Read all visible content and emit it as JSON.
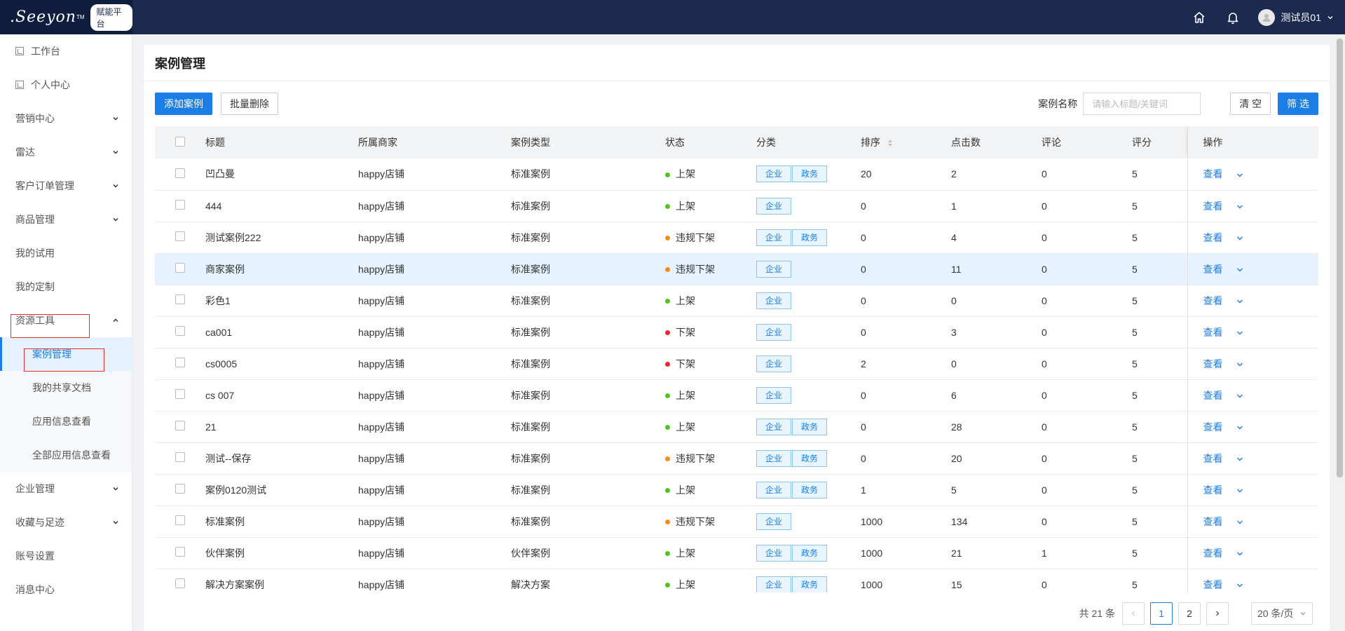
{
  "header": {
    "logo_text": ".Seeyon",
    "logo_tm": "TM",
    "platform_badge": "赋能平台",
    "user_name": "测试员01"
  },
  "sidebar": {
    "items": [
      {
        "label": "工作台",
        "icon": "square-icon"
      },
      {
        "label": "个人中心",
        "icon": "square-icon"
      },
      {
        "label": "营销中心",
        "expandable": true
      },
      {
        "label": "雷达",
        "expandable": true
      },
      {
        "label": "客户订单管理",
        "expandable": true
      },
      {
        "label": "商品管理",
        "expandable": true
      },
      {
        "label": "我的试用"
      },
      {
        "label": "我的定制"
      },
      {
        "label": "资源工具",
        "expandable": true,
        "expanded": true
      },
      {
        "label": "企业管理",
        "expandable": true
      },
      {
        "label": "收藏与足迹",
        "expandable": true
      },
      {
        "label": "账号设置"
      },
      {
        "label": "消息中心"
      }
    ],
    "resource_sub_items": [
      {
        "label": "案例管理",
        "active": true
      },
      {
        "label": "我的共享文档"
      },
      {
        "label": "应用信息查看"
      },
      {
        "label": "全部应用信息查看"
      }
    ]
  },
  "page": {
    "title": "案例管理",
    "add_button": "添加案例",
    "batch_delete_button": "批量删除",
    "filter_label": "案例名称",
    "filter_placeholder": "请输入标题/关键词",
    "clear_button": "清 空",
    "filter_button": "筛 选"
  },
  "table": {
    "columns": [
      "标题",
      "所属商家",
      "案例类型",
      "状态",
      "分类",
      "排序",
      "点击数",
      "评论",
      "评分",
      "操作"
    ],
    "view_label": "查看",
    "rows": [
      {
        "title": "凹凸曼",
        "merchant": "happy店铺",
        "type": "标准案例",
        "status": "上架",
        "status_color": "#52c41a",
        "tags": [
          "企业",
          "政务"
        ],
        "sort": "20",
        "clicks": "2",
        "comments": "0",
        "rating": "5"
      },
      {
        "title": "444",
        "merchant": "happy店铺",
        "type": "标准案例",
        "status": "上架",
        "status_color": "#52c41a",
        "tags": [
          "企业"
        ],
        "sort": "0",
        "clicks": "1",
        "comments": "0",
        "rating": "5"
      },
      {
        "title": "测试案例222",
        "merchant": "happy店铺",
        "type": "标准案例",
        "status": "违规下架",
        "status_color": "#fa8c16",
        "tags": [
          "企业",
          "政务"
        ],
        "sort": "0",
        "clicks": "4",
        "comments": "0",
        "rating": "5"
      },
      {
        "title": "商家案例",
        "merchant": "happy店铺",
        "type": "标准案例",
        "status": "违规下架",
        "status_color": "#fa8c16",
        "tags": [
          "企业"
        ],
        "sort": "0",
        "clicks": "11",
        "comments": "0",
        "rating": "5",
        "highlight": true
      },
      {
        "title": "彩色1",
        "merchant": "happy店铺",
        "type": "标准案例",
        "status": "上架",
        "status_color": "#52c41a",
        "tags": [
          "企业"
        ],
        "sort": "0",
        "clicks": "0",
        "comments": "0",
        "rating": "5"
      },
      {
        "title": "ca001",
        "merchant": "happy店铺",
        "type": "标准案例",
        "status": "下架",
        "status_color": "#f5222d",
        "tags": [
          "企业"
        ],
        "sort": "0",
        "clicks": "3",
        "comments": "0",
        "rating": "5"
      },
      {
        "title": "cs0005",
        "merchant": "happy店铺",
        "type": "标准案例",
        "status": "下架",
        "status_color": "#f5222d",
        "tags": [
          "企业"
        ],
        "sort": "2",
        "clicks": "0",
        "comments": "0",
        "rating": "5"
      },
      {
        "title": "cs 007",
        "merchant": "happy店铺",
        "type": "标准案例",
        "status": "上架",
        "status_color": "#52c41a",
        "tags": [
          "企业"
        ],
        "sort": "0",
        "clicks": "6",
        "comments": "0",
        "rating": "5"
      },
      {
        "title": "21",
        "merchant": "happy店铺",
        "type": "标准案例",
        "status": "上架",
        "status_color": "#52c41a",
        "tags": [
          "企业",
          "政务"
        ],
        "sort": "0",
        "clicks": "28",
        "comments": "0",
        "rating": "5"
      },
      {
        "title": "测试--保存",
        "merchant": "happy店铺",
        "type": "标准案例",
        "status": "违规下架",
        "status_color": "#fa8c16",
        "tags": [
          "企业",
          "政务"
        ],
        "sort": "0",
        "clicks": "20",
        "comments": "0",
        "rating": "5"
      },
      {
        "title": "案例0120测试",
        "merchant": "happy店铺",
        "type": "标准案例",
        "status": "上架",
        "status_color": "#52c41a",
        "tags": [
          "企业",
          "政务"
        ],
        "sort": "1",
        "clicks": "5",
        "comments": "0",
        "rating": "5"
      },
      {
        "title": "标准案例",
        "merchant": "happy店铺",
        "type": "标准案例",
        "status": "违规下架",
        "status_color": "#fa8c16",
        "tags": [
          "企业"
        ],
        "sort": "1000",
        "clicks": "134",
        "comments": "0",
        "rating": "5"
      },
      {
        "title": "伙伴案例",
        "merchant": "happy店铺",
        "type": "伙伴案例",
        "status": "上架",
        "status_color": "#52c41a",
        "tags": [
          "企业",
          "政务"
        ],
        "sort": "1000",
        "clicks": "21",
        "comments": "1",
        "rating": "5"
      },
      {
        "title": "解决方案案例",
        "merchant": "happy店铺",
        "type": "解决方案",
        "status": "上架",
        "status_color": "#52c41a",
        "tags": [
          "企业",
          "政务"
        ],
        "sort": "1000",
        "clicks": "15",
        "comments": "0",
        "rating": "5"
      }
    ]
  },
  "pagination": {
    "total": "共 21 条",
    "prev": "<",
    "pages": [
      "1",
      "2"
    ],
    "current": "1",
    "next": ">",
    "page_size": "20 条/页"
  }
}
